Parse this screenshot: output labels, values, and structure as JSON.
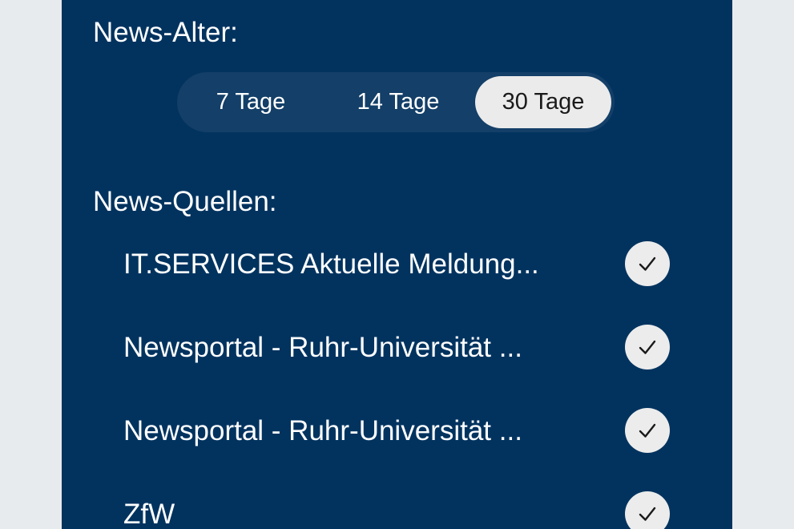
{
  "settings": {
    "age_label": "News-Alter:",
    "age_options": [
      {
        "label": "7 Tage",
        "selected": false
      },
      {
        "label": "14 Tage",
        "selected": false
      },
      {
        "label": "30 Tage",
        "selected": true
      }
    ],
    "sources_label": "News-Quellen:",
    "sources": [
      {
        "name": "IT.SERVICES Aktuelle Meldung...",
        "checked": true,
        "icon": "checkmark-icon"
      },
      {
        "name": "Newsportal - Ruhr-Universität ...",
        "checked": true,
        "icon": "checkmark-icon"
      },
      {
        "name": "Newsportal - Ruhr-Universität ...",
        "checked": true,
        "icon": "checkmark-icon"
      },
      {
        "name": "ZfW",
        "checked": true,
        "icon": "checkmark-icon"
      }
    ]
  },
  "colors": {
    "page_background": "#e8ebee",
    "panel_background": "#02335f",
    "segment_track": "#133f68",
    "segment_selected": "#ebebeb",
    "check_background": "#ececec",
    "text_light": "#ffffff"
  }
}
